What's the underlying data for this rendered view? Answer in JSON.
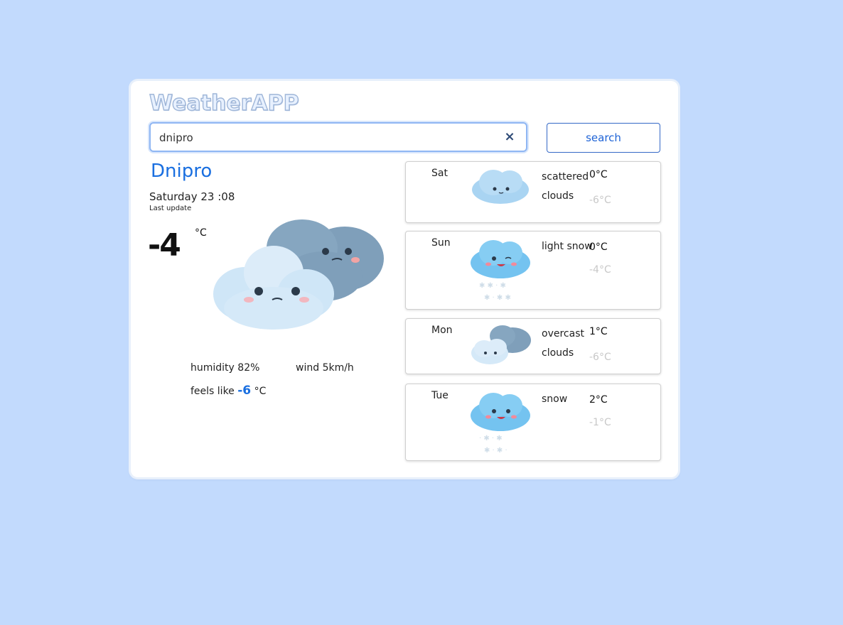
{
  "app": {
    "title": "WeatherAPP"
  },
  "search": {
    "value": "dnipro",
    "placeholder": "",
    "clear_icon": "×",
    "button_label": "search"
  },
  "current": {
    "city": "Dnipro",
    "date": "Saturday 23 :08",
    "last_update": "Last update",
    "temperature": "-4",
    "unit": "°C",
    "icon": "overcast-clouds-icon",
    "humidity_label": "humidity",
    "humidity_value": "82%",
    "wind_label": "wind",
    "wind_value": "5km/h",
    "feels_label": "feels like",
    "feels_value": "-6",
    "feels_unit": "°C"
  },
  "forecast": [
    {
      "day": "Sat",
      "desc": "scattered clouds",
      "max": "0°C",
      "min": "-6°C",
      "icon": "scattered-clouds-icon"
    },
    {
      "day": "Sun",
      "desc": "light snow",
      "max": "0°C",
      "min": "-4°C",
      "icon": "light-snow-icon"
    },
    {
      "day": "Mon",
      "desc": "overcast clouds",
      "max": "1°C",
      "min": "-6°C",
      "icon": "overcast-clouds-icon"
    },
    {
      "day": "Tue",
      "desc": "snow",
      "max": "2°C",
      "min": "-1°C",
      "icon": "snow-icon"
    }
  ],
  "colors": {
    "background": "#c2dafd",
    "accent": "#1a6fe0",
    "cloud_light": "#cfe6f7",
    "cloud_dark": "#7f9fba"
  }
}
